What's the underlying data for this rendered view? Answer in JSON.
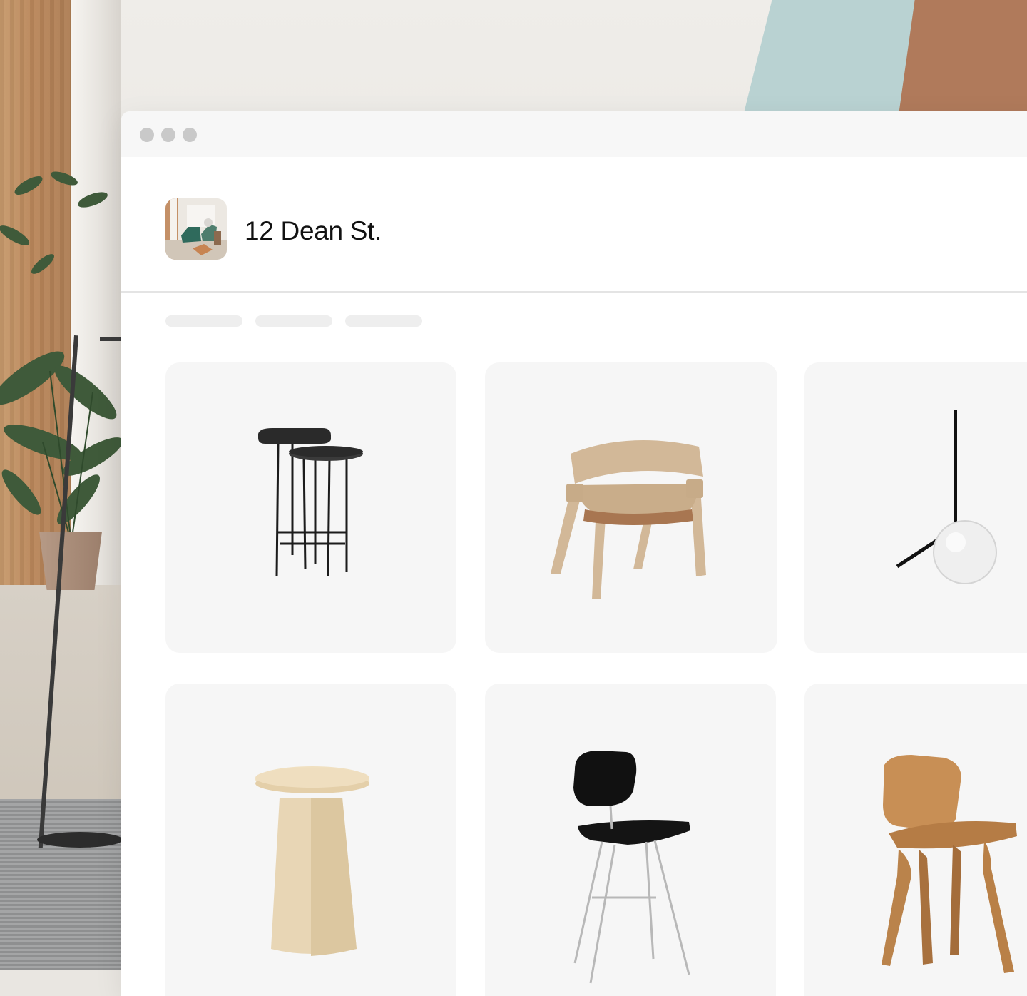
{
  "window": {
    "controls": [
      "close-dot",
      "minimize-dot",
      "maximize-dot"
    ]
  },
  "project": {
    "title": "12 Dean St.",
    "thumbnail_icon": "room-photo-thumbnail"
  },
  "filters": {
    "pills": [
      "filter-placeholder-1",
      "filter-placeholder-2",
      "filter-placeholder-3"
    ]
  },
  "products": [
    {
      "name": "nesting-side-tables-icon"
    },
    {
      "name": "oak-lounge-chair-icon"
    },
    {
      "name": "globe-pendant-lamp-icon"
    },
    {
      "name": "pine-side-table-icon"
    },
    {
      "name": "black-molded-chair-icon"
    },
    {
      "name": "plywood-lounge-chair-icon"
    }
  ],
  "colors": {
    "card_bg": "#f6f6f6",
    "title_text": "#111111",
    "divider": "#e4e4e4",
    "window_dot": "#c9c9c9"
  }
}
